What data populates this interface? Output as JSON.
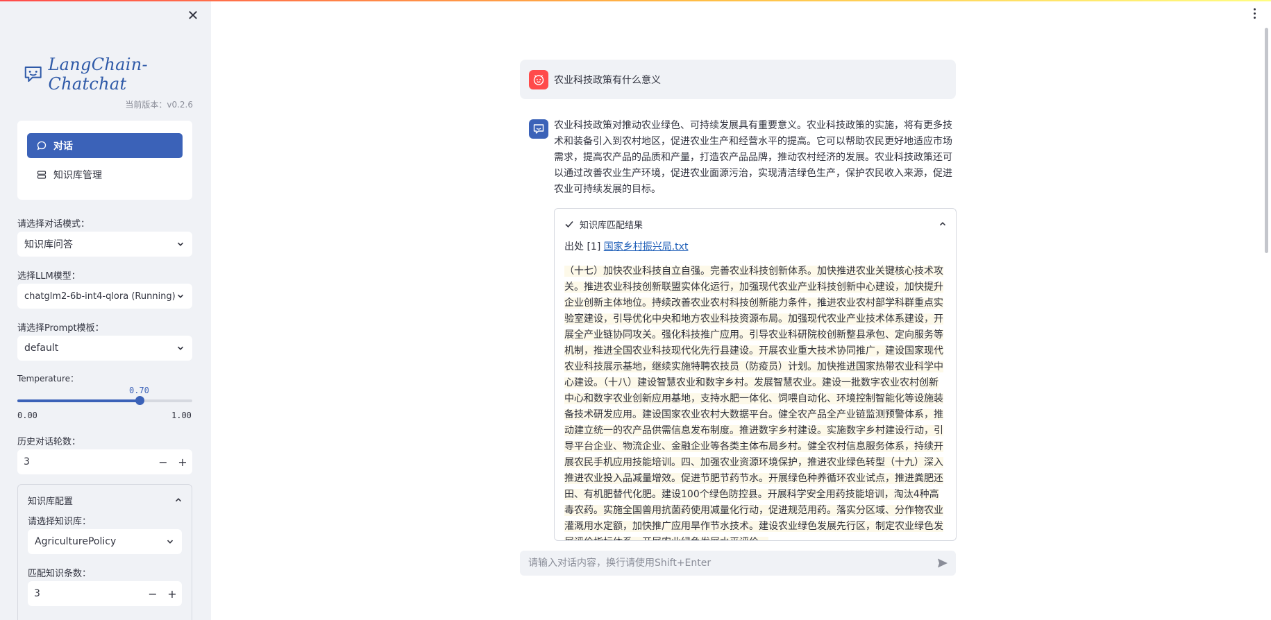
{
  "app": {
    "logo_text": "LangChain-Chatchat",
    "version": "当前版本：v0.2.6",
    "accent": "#3b62b8"
  },
  "sidebar": {
    "nav": [
      {
        "label": "对话",
        "icon": "chat-bubble-icon",
        "active": true
      },
      {
        "label": "知识库管理",
        "icon": "database-icon",
        "active": false
      }
    ],
    "dialog_mode": {
      "label": "请选择对话模式：",
      "value": "知识库问答"
    },
    "llm_model": {
      "label": "选择LLM模型：",
      "value": "chatglm2-6b-int4-qlora (Running)"
    },
    "prompt_template": {
      "label": "请选择Prompt模板：",
      "value": "default"
    },
    "temperature": {
      "label": "Temperature：",
      "value": "0.70",
      "min": "0.00",
      "max": "1.00",
      "fraction": 0.7
    },
    "history_rounds": {
      "label": "历史对话轮数：",
      "value": "3"
    },
    "kb_config": {
      "title": "知识库配置",
      "kb_label": "请选择知识库：",
      "kb_value": "AgriculturePolicy",
      "match_label": "匹配知识条数：",
      "match_value": "3"
    }
  },
  "chat": {
    "user_message": "农业科技政策有什么意义",
    "bot_message": "农业科技政策对推动农业绿色、可持续发展具有重要意义。农业科技政策的实施，将有更多技术和装备引入到农村地区，促进农业生产和经营水平的提高。它可以帮助农民更好地适应市场需求，提高农产品的品质和产量，打造农产品品牌，推动农村经济的发展。农业科技政策还可以通过改善农业生产环境，促进农业面源污治，实现清洁绿色生产，保护农民收入来源，促进农业可持续发展的目标。",
    "kb_result": {
      "title": "知识库匹配结果",
      "source_prefix": "出处 [1]",
      "source_link": "国家乡村振兴局.txt",
      "content": "（十七）加快农业科技自立自强。完善农业科技创新体系。加快推进农业关键核心技术攻关。推进农业科技创新联盟实体化运行，加强现代农业产业科技创新中心建设，加快提升企业创新主体地位。持续改善农业农村科技创新能力条件，推进农业农村部学科群重点实验室建设，引导优化中央和地方农业科技资源布局。加强现代农业产业技术体系建设，开展全产业链协同攻关。强化科技推广应用。引导农业科研院校创新整县承包、定向服务等机制，推进全国农业科技现代化先行县建设。开展农业重大技术协同推广，建设国家现代农业科技展示基地，继续实施特聘农技员（防疫员）计划。加快推进国家热带农业科学中心建设。（十八）建设智慧农业和数字乡村。发展智慧农业。建设一批数字农业农村创新中心和数字农业创新应用基地，支持水肥一体化、饲喂自动化、环境控制智能化等设施装备技术研发应用。建设国家农业农村大数据平台。健全农产品全产业链监测预警体系，推动建立统一的农产品供需信息发布制度。推进数字乡村建设。实施数字乡村建设行动，引导平台企业、物流企业、金融企业等各类主体布局乡村。健全农村信息服务体系，持续开展农民手机应用技能培训。四、加强农业资源环境保护，推进农业绿色转型（十九）深入推进农业投入品减量增效。促进节肥节药节水。开展绿色种养循环农业试点，推进粪肥还田、有机肥替代化肥。建设100个绿色防控县。开展科学安全用药技能培训，淘汰4种高毒农药。实施全国兽用抗菌药使用减量化行动，促进规范用药。落实分区域、分作物农业灌溉用水定额，加快推广应用旱作节水技术。建设农业绿色发展先行区，制定农业绿色发展评价指标体系，开展农业绿色发展水平评价。"
    },
    "input_placeholder": "请输入对话内容，换行请使用Shift+Enter"
  }
}
